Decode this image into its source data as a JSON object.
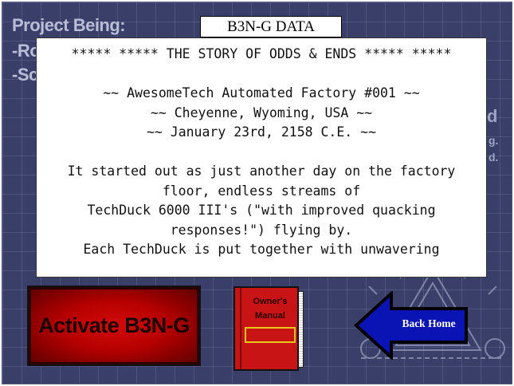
{
  "background": {
    "blueprint_title": "Project Being:",
    "blueprint_line1": "-Ro",
    "blueprint_line2": "-Sc"
  },
  "data_tab": {
    "label": "B3N-G DATA"
  },
  "story": {
    "lines": [
      "***** ***** THE STORY OF ODDS & ENDS ***** *****",
      "",
      "~~ AwesomeTech Automated Factory #001 ~~",
      "~~ Cheyenne, Wyoming, USA ~~",
      "~~ January 23rd, 2158 C.E. ~~",
      "",
      "It started out as just another day on the factory",
      "floor, endless streams of",
      "TechDuck 6000 III's (\"with improved quacking",
      "responses!\") flying by.",
      "Each TechDuck is put together with unwavering"
    ]
  },
  "activate": {
    "label": "Activate B3N-G"
  },
  "manual": {
    "title_line1": "Owner's",
    "title_line2": "Manual"
  },
  "back_home": {
    "label": "Back Home"
  },
  "colors": {
    "background": "#3a3f6a",
    "activate_red": "#d40a0a",
    "manual_red": "#c81414",
    "back_arrow_blue": "#0a14b4",
    "label_yellow": "#e8c61a"
  }
}
